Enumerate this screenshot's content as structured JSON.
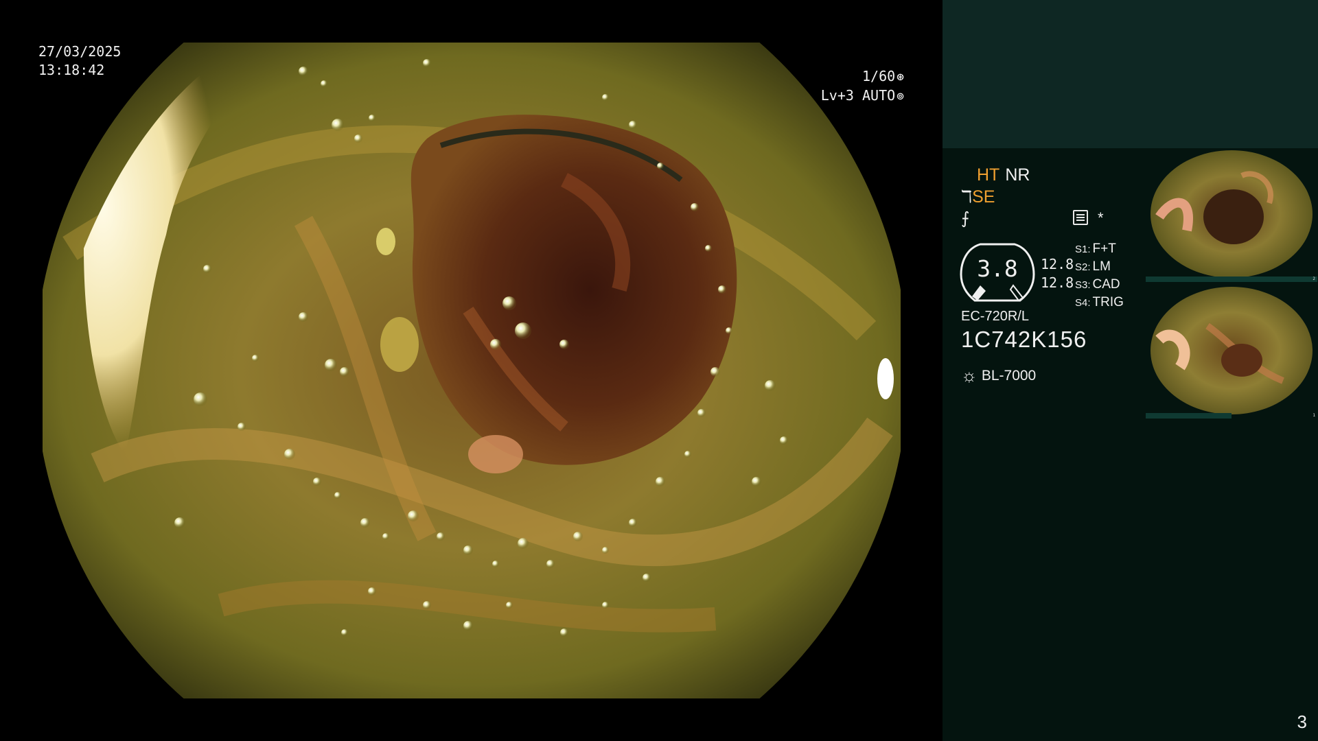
{
  "osd": {
    "date": "27/03/2025",
    "time": "13:18:42",
    "shutter": "1/60",
    "shutter_icon": "aperture-icon",
    "level": "Lv+3",
    "iris": "AUTO",
    "iris_icon": "iris-icon"
  },
  "panel": {
    "mode_ht": "HT",
    "mode_nr": "NR",
    "mode_se": "SE",
    "mode_prefix_icon": "structure-enhance-icon",
    "mode_line3_icon": "color-mode-icon",
    "settings_icon": "menu-icon",
    "star": "*",
    "gauge_value": "3.8",
    "voltage_1": "12.8",
    "voltage_2": "12.8",
    "switches": [
      {
        "key": "S1:",
        "value": "F+T"
      },
      {
        "key": "S2:",
        "value": "LM"
      },
      {
        "key": "S3:",
        "value": "CAD"
      },
      {
        "key": "S4:",
        "value": "TRIG"
      }
    ],
    "scope_model": "EC-720R/L",
    "scope_serial": "1C742K156",
    "light_source_icon": "light-source-icon",
    "light_source": "BL-7000"
  },
  "thumbnails": [
    {
      "index": "2"
    },
    {
      "index": "1"
    }
  ],
  "page_number": "3",
  "colors": {
    "panel_bg": "#04140f",
    "panel_top": "#0e2723",
    "accent_orange": "#f0a030",
    "text": "#f0f0f0"
  }
}
